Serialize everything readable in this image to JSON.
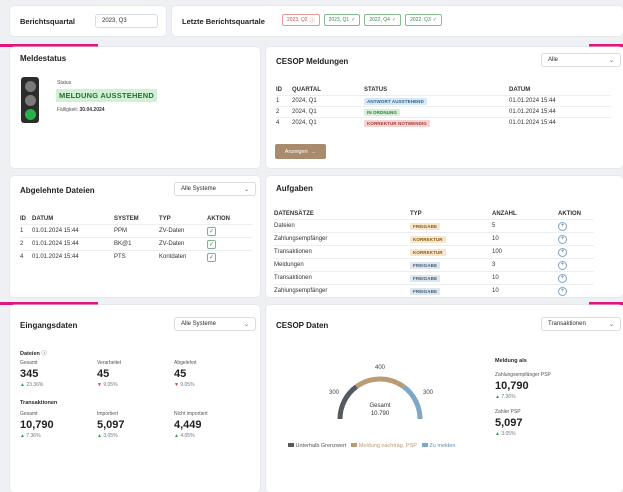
{
  "header": {
    "report_quarter_label": "Berichtsquartal",
    "report_quarter_value": "2023, Q3",
    "last_quarters_label": "Letzte Berichtsquartale",
    "quarters": [
      {
        "label": "2023, Q2",
        "status": "warning"
      },
      {
        "label": "2023, Q1",
        "status": "ok"
      },
      {
        "label": "2022, Q4",
        "status": "ok"
      },
      {
        "label": "2022, Q3",
        "status": "ok"
      }
    ]
  },
  "meldestatus": {
    "title": "Meldestatus",
    "status_label": "Status",
    "status_value": "MELDUNG AUSSTEHEND",
    "due_label": "Fälligkeit:",
    "due_value": "30.04.2024"
  },
  "cesop_meldungen": {
    "title": "CESOP Meldungen",
    "filter": "Alle",
    "columns": [
      "ID",
      "QUARTAL",
      "STATUS",
      "DATUM"
    ],
    "rows": [
      {
        "id": "1",
        "quarter": "2024, Q1",
        "status": "ANTWORT AUSSTEHEND",
        "date": "01.01.2024 15:44"
      },
      {
        "id": "2",
        "quarter": "2024, Q1",
        "status": "IN ORDNUNG",
        "date": "01.01.2024 15:44"
      },
      {
        "id": "4",
        "quarter": "2024, Q1",
        "status": "KORREKTUR NOTWENDIG",
        "date": "01.01.2024 15:44"
      }
    ],
    "button_label": "Anzeigen"
  },
  "abgelehnte_dateien": {
    "title": "Abgelehnte Dateien",
    "filter": "Alle Systeme",
    "columns": [
      "ID",
      "DATUM",
      "SYSTEM",
      "TYP",
      "AKTION"
    ],
    "rows": [
      {
        "id": "1",
        "date": "01.01.2024 15:44",
        "system": "PPM",
        "type": "ZV-Daten"
      },
      {
        "id": "2",
        "date": "01.01.2024 15:44",
        "system": "BK@1",
        "type": "ZV-Daten"
      },
      {
        "id": "4",
        "date": "01.01.2024 15:44",
        "system": "PTS",
        "type": "Kontdaten"
      }
    ]
  },
  "aufgaben": {
    "title": "Aufgaben",
    "columns": [
      "DATENSÄTZE",
      "TYP",
      "ANZAHL",
      "AKTION"
    ],
    "rows": [
      {
        "name": "Dateien",
        "type": "FREIGABE",
        "count": "5",
        "tone": "orange"
      },
      {
        "name": "Zahlungsempfänger",
        "type": "KORREKTUR",
        "count": "10",
        "tone": "orange"
      },
      {
        "name": "Transaktionen",
        "type": "KORREKTUR",
        "count": "100",
        "tone": "orange"
      },
      {
        "name": "Meldungen",
        "type": "FREIGABE",
        "count": "3",
        "tone": "grayblue"
      },
      {
        "name": "Transaktionen",
        "type": "FREIGABE",
        "count": "10",
        "tone": "grayblue"
      },
      {
        "name": "Zahlungsempfänger",
        "type": "FREIGABE",
        "count": "10",
        "tone": "grayblue"
      }
    ]
  },
  "eingangsdaten": {
    "title": "Eingangsdaten",
    "filter": "Alle Systeme",
    "dateien_label": "Dateien",
    "dateien": [
      {
        "label": "Gesamt",
        "value": "345",
        "delta": "23.36%",
        "dir": "up"
      },
      {
        "label": "Verarbeitet",
        "value": "45",
        "delta": "9.05%",
        "dir": "down"
      },
      {
        "label": "Abgelehnt",
        "value": "45",
        "delta": "9.05%",
        "dir": "down"
      }
    ],
    "transaktionen_label": "Transaktionen",
    "transaktionen": [
      {
        "label": "Gesamt",
        "value": "10,790",
        "delta": "7.36%",
        "dir": "up"
      },
      {
        "label": "Importiert",
        "value": "5,097",
        "delta": "3.05%",
        "dir": "up"
      },
      {
        "label": "Nicht importiert",
        "value": "4,449",
        "delta": "4.05%",
        "dir": "up"
      }
    ]
  },
  "cesop_daten": {
    "title": "CESOP Daten",
    "filter": "Transaktionen",
    "gauge": {
      "center_label": "Gesamt",
      "center_value": "10.790",
      "tick_left": "300",
      "tick_top": "400",
      "tick_right": "300",
      "segments": [
        {
          "name": "Unterhalb Grenzwert",
          "value": 300,
          "color": "#555a60"
        },
        {
          "name": "Meldung nachträg. PSP",
          "value": 400,
          "color": "#b99b74"
        },
        {
          "name": "Zu melden",
          "value": 300,
          "color": "#7ea7c6"
        }
      ]
    },
    "side_title": "Meldung als",
    "side": [
      {
        "label": "Zahlungsempfänger PSP",
        "value": "10,790",
        "delta": "7.36%"
      },
      {
        "label": "Zahler PSP",
        "value": "5,097",
        "delta": "3.05%"
      }
    ]
  }
}
